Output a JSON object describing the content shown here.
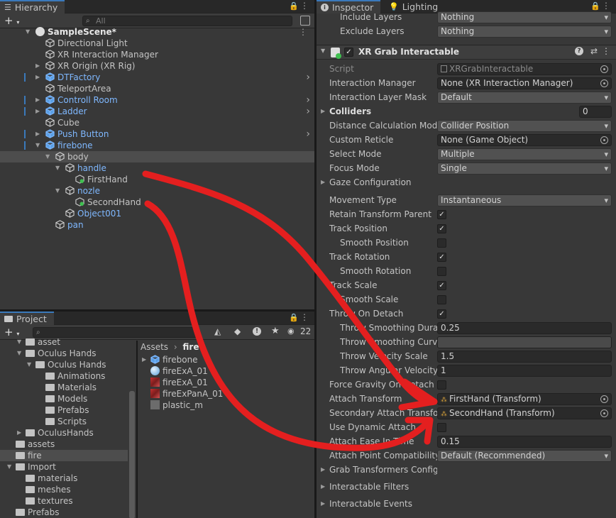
{
  "hierarchy": {
    "tab_label": "Hierarchy",
    "search_placeholder": "All",
    "items": [
      {
        "label": "SampleScene*",
        "depth": 0,
        "kind": "scene",
        "expanded": true
      },
      {
        "label": "Directional Light",
        "depth": 1,
        "kind": "object"
      },
      {
        "label": "XR Interaction Manager",
        "depth": 1,
        "kind": "object"
      },
      {
        "label": "XR Origin (XR Rig)",
        "depth": 1,
        "kind": "object",
        "collapsed": true
      },
      {
        "label": "DTFactory",
        "depth": 1,
        "kind": "prefab",
        "collapsed": true,
        "more": true
      },
      {
        "label": "TeleportArea",
        "depth": 1,
        "kind": "object"
      },
      {
        "label": "Controll Room",
        "depth": 1,
        "kind": "prefab",
        "collapsed": true,
        "more": true
      },
      {
        "label": "Ladder",
        "depth": 1,
        "kind": "prefab",
        "collapsed": true,
        "more": true
      },
      {
        "label": "Cube",
        "depth": 1,
        "kind": "object"
      },
      {
        "label": "Push Button",
        "depth": 1,
        "kind": "prefab",
        "collapsed": true,
        "more": true
      },
      {
        "label": "firebone",
        "depth": 1,
        "kind": "prefab",
        "expanded": true
      },
      {
        "label": "body",
        "depth": 2,
        "kind": "object",
        "expanded": true,
        "selected": true
      },
      {
        "label": "handle",
        "depth": 3,
        "kind": "object-blue",
        "expanded": true
      },
      {
        "label": "FirstHand",
        "depth": 4,
        "kind": "attach"
      },
      {
        "label": "nozle",
        "depth": 3,
        "kind": "object-blue",
        "expanded": true
      },
      {
        "label": "SecondHand",
        "depth": 4,
        "kind": "attach"
      },
      {
        "label": "Object001",
        "depth": 3,
        "kind": "object-blue"
      },
      {
        "label": "pan",
        "depth": 2,
        "kind": "object-blue"
      }
    ]
  },
  "project": {
    "tab_label": "Project",
    "badge_count": "22",
    "breadcrumb": [
      "Assets",
      "fire"
    ],
    "tree": [
      {
        "label": "asset",
        "depth": 1,
        "expanded": true
      },
      {
        "label": "Oculus Hands",
        "depth": 1,
        "expanded": true
      },
      {
        "label": "Oculus Hands",
        "depth": 2,
        "expanded": true
      },
      {
        "label": "Animations",
        "depth": 3
      },
      {
        "label": "Materials",
        "depth": 3
      },
      {
        "label": "Models",
        "depth": 3
      },
      {
        "label": "Prefabs",
        "depth": 3
      },
      {
        "label": "Scripts",
        "depth": 3
      },
      {
        "label": "OculusHands",
        "depth": 1,
        "collapsed": true
      },
      {
        "label": "assets",
        "depth": 0
      },
      {
        "label": "fire",
        "depth": 0,
        "selected": true
      },
      {
        "label": "Import",
        "depth": 0,
        "expanded": true
      },
      {
        "label": "materials",
        "depth": 1
      },
      {
        "label": "meshes",
        "depth": 1
      },
      {
        "label": "textures",
        "depth": 1
      },
      {
        "label": "Prefabs",
        "depth": 0
      }
    ],
    "files": [
      {
        "label": "firebone",
        "kind": "prefab"
      },
      {
        "label": "fireExA_01",
        "kind": "material"
      },
      {
        "label": "fireExA_01",
        "kind": "texture"
      },
      {
        "label": "fireExPanA_01",
        "kind": "texture"
      },
      {
        "label": "plastic_m",
        "kind": "gray"
      }
    ]
  },
  "inspector": {
    "tabs": [
      {
        "label": "Inspector",
        "active": true
      },
      {
        "label": "Lighting",
        "active": false
      }
    ],
    "top_props": [
      {
        "label": "Include Layers",
        "value": "Nothing",
        "kind": "dropdown"
      },
      {
        "label": "Exclude Layers",
        "value": "Nothing",
        "kind": "dropdown"
      }
    ],
    "component_title": "XR Grab Interactable",
    "props": [
      {
        "label": "Script",
        "value": "XRGrabInteractable",
        "kind": "object",
        "dim": true
      },
      {
        "label": "Interaction Manager",
        "value": "None (XR Interaction Manager)",
        "kind": "object"
      },
      {
        "label": "Interaction Layer Mask",
        "value": "Default",
        "kind": "dropdown"
      },
      {
        "label": "Colliders",
        "value": "0",
        "kind": "count",
        "foldout": true,
        "bold": true
      },
      {
        "label": "Distance Calculation Mode",
        "value": "Collider Position",
        "kind": "dropdown"
      },
      {
        "label": "Custom Reticle",
        "value": "None (Game Object)",
        "kind": "object"
      },
      {
        "label": "Select Mode",
        "value": "Multiple",
        "kind": "dropdown"
      },
      {
        "label": "Focus Mode",
        "value": "Single",
        "kind": "dropdown"
      },
      {
        "label": "Gaze Configuration",
        "value": "",
        "kind": "foldout"
      },
      {
        "label": "Movement Type",
        "value": "Instantaneous",
        "kind": "dropdown",
        "gap": true
      },
      {
        "label": "Retain Transform Parent",
        "value": "✓",
        "kind": "check"
      },
      {
        "label": "Track Position",
        "value": "✓",
        "kind": "check"
      },
      {
        "label": "Smooth Position",
        "value": "",
        "kind": "check",
        "indent": true
      },
      {
        "label": "Track Rotation",
        "value": "✓",
        "kind": "check"
      },
      {
        "label": "Smooth Rotation",
        "value": "",
        "kind": "check",
        "indent": true
      },
      {
        "label": "Track Scale",
        "value": "✓",
        "kind": "check"
      },
      {
        "label": "Smooth Scale",
        "value": "",
        "kind": "check",
        "indent": true
      },
      {
        "label": "Throw On Detach",
        "value": "✓",
        "kind": "check"
      },
      {
        "label": "Throw Smoothing Duration",
        "value": "0.25",
        "kind": "text",
        "indent": true
      },
      {
        "label": "Throw Smoothing Curve",
        "value": "",
        "kind": "curve",
        "indent": true
      },
      {
        "label": "Throw Velocity Scale",
        "value": "1.5",
        "kind": "text",
        "indent": true
      },
      {
        "label": "Throw Angular Velocity",
        "value": "1",
        "kind": "text",
        "indent": true
      },
      {
        "label": "Force Gravity On Detach",
        "value": "",
        "kind": "check"
      },
      {
        "label": "Attach Transform",
        "value": "FirstHand (Transform)",
        "kind": "object"
      },
      {
        "label": "Secondary Attach Transform",
        "value": "SecondHand (Transform)",
        "kind": "object"
      },
      {
        "label": "Use Dynamic Attach",
        "value": "",
        "kind": "check"
      },
      {
        "label": "Attach Ease In Time",
        "value": "0.15",
        "kind": "text"
      },
      {
        "label": "Attach Point Compatibility",
        "value": "Default (Recommended)",
        "kind": "dropdown"
      },
      {
        "label": "Grab Transformers Configuration",
        "value": "",
        "kind": "foldout"
      },
      {
        "label": "Interactable Filters",
        "value": "",
        "kind": "foldout"
      },
      {
        "label": "Interactable Events",
        "value": "",
        "kind": "foldout"
      }
    ]
  },
  "colors": {
    "accent": "#3a79bb",
    "prefab_blue": "#7fb8ff",
    "annotation": "#e41f1f"
  }
}
